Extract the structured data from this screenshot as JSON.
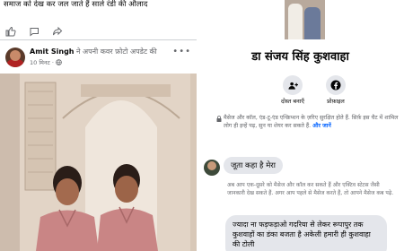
{
  "feed": {
    "post_text": "समाज को देख कर जल जाते हैं साले रंडी की औलाद",
    "post2": {
      "author": "Amit Singh",
      "action": " ने अपनी कवर फ़ोटो अपडेट की",
      "time": "10 मिनट",
      "privacy_icon": "globe-icon",
      "menu_icon": "more-dots-icon"
    }
  },
  "panel": {
    "profile_name": "डा संजय सिंह कुशवाहा",
    "buttons": [
      {
        "label": "दोस्त बनाएँ",
        "icon": "add-friend-icon"
      },
      {
        "label": "प्रोफ़ाइल",
        "icon": "facebook-icon"
      }
    ],
    "encryption_text": "मैसेज और कॉल, एंड-टू-एंड एन्क्रिप्शन के ज़रिए सुरक्षित होते हैं. सिर्फ़ इस चैट में शामिल लोग ही इन्हें पढ़, सुन या शेयर कर सकते हैं.",
    "learn_more": "और जानें",
    "message1": "जूता कहा है मेरा",
    "notice_text": "अब आप एक-दूसरे को मैसेज और कॉल कर सकते हैं और एक्टिव स्टेटस जैसी जानकारी देख सकते हैं. अगर आप पहले से मैसेज करते हैं, तो आपने मैसेज कब पढ़े.",
    "message2": "ज्यादा ना फड़फड़ाओ गदरिया से लेकर रूपापुर तक कुशवाहों का डंका बजता है अकेली हमारी ही कुशवाहा की टोली"
  },
  "colors": {
    "link": "#0866ff",
    "bubble": "#e4e6eb",
    "secondary_text": "#65676b"
  }
}
